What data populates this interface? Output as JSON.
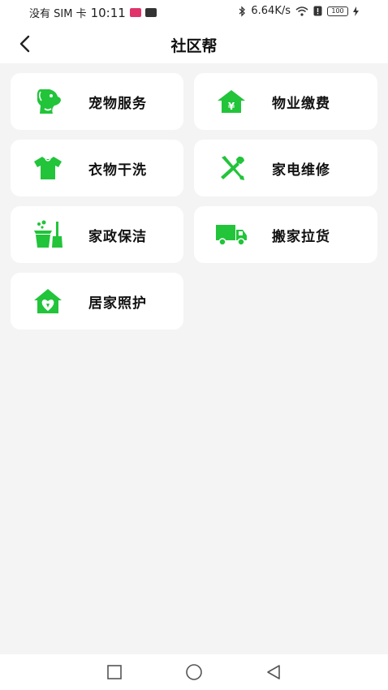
{
  "status": {
    "carrier": "没有 SIM 卡",
    "time": "10:11",
    "speed": "6.64K/s",
    "battery": "100"
  },
  "header": {
    "title": "社区帮"
  },
  "services": [
    {
      "label": "宠物服务",
      "icon": "pet-dog-icon"
    },
    {
      "label": "物业缴费",
      "icon": "house-yuan-icon"
    },
    {
      "label": "衣物干洗",
      "icon": "shirt-icon"
    },
    {
      "label": "家电维修",
      "icon": "tools-icon"
    },
    {
      "label": "家政保洁",
      "icon": "cleaning-icon"
    },
    {
      "label": "搬家拉货",
      "icon": "truck-icon"
    },
    {
      "label": "居家照护",
      "icon": "home-care-icon"
    }
  ],
  "colors": {
    "accent": "#22c43a",
    "background": "#f4f4f4",
    "card": "#ffffff"
  }
}
